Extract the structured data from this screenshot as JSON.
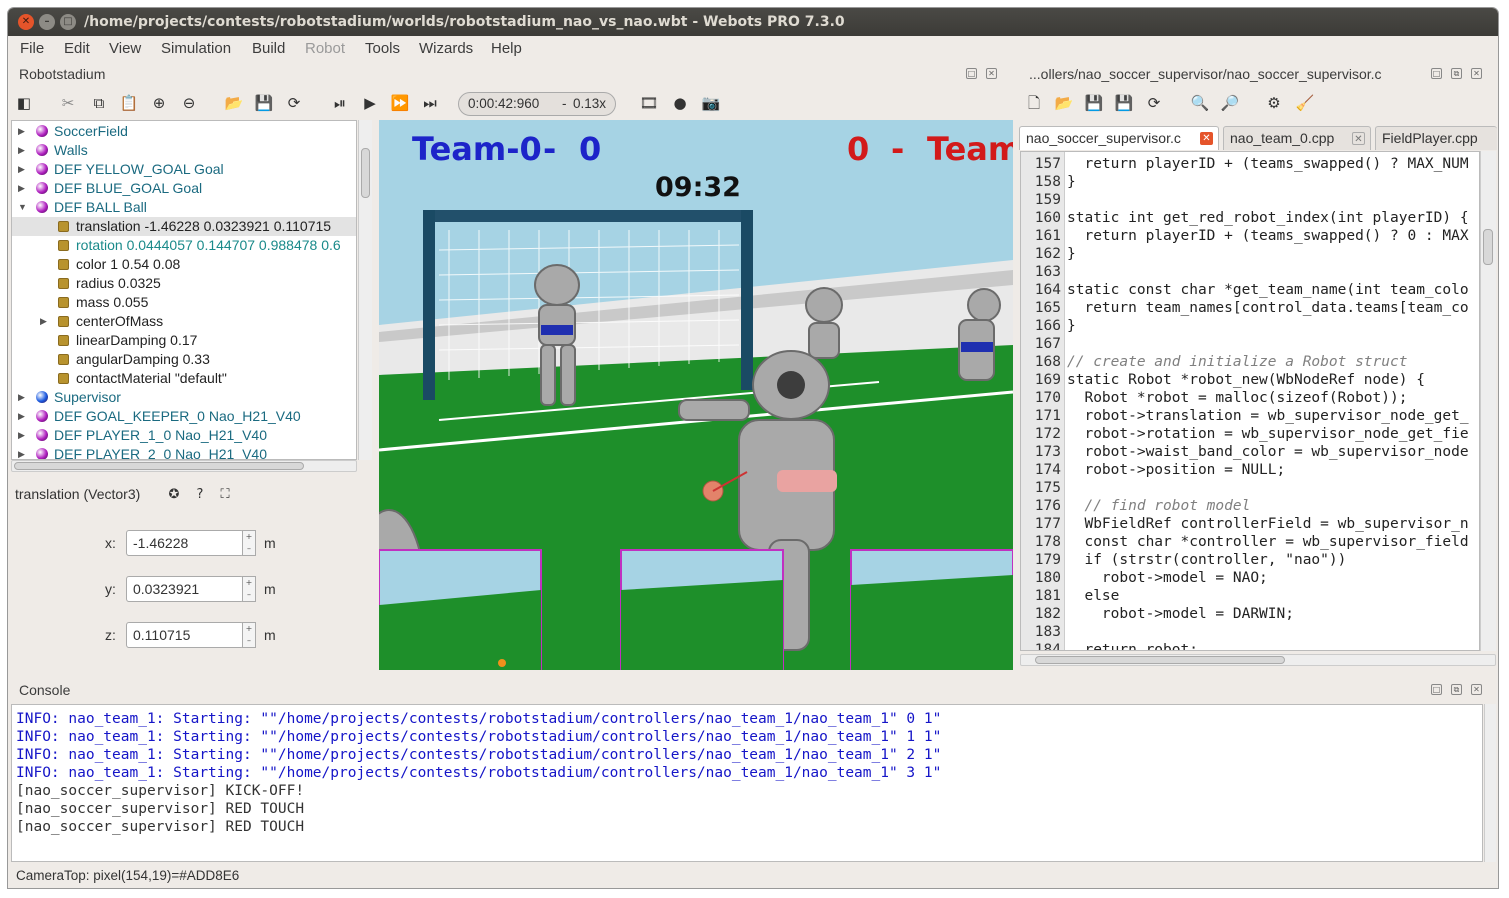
{
  "window": {
    "title": "/home/projects/contests/robotstadium/worlds/robotstadium_nao_vs_nao.wbt - Webots PRO 7.3.0"
  },
  "menu": [
    "File",
    "Edit",
    "View",
    "Simulation",
    "Build",
    "Robot",
    "Tools",
    "Wizards",
    "Help"
  ],
  "scene_panel": {
    "title": "Robotstadium",
    "sim_time": "0:00:42:960",
    "speed": "0.13x"
  },
  "tree": [
    {
      "label": "SoccerField",
      "kind": "node",
      "color": "#b020c0"
    },
    {
      "label": "Walls",
      "kind": "node",
      "color": "#b020c0"
    },
    {
      "label": "DEF YELLOW_GOAL Goal",
      "kind": "node",
      "color": "#b020c0"
    },
    {
      "label": "DEF BLUE_GOAL Goal",
      "kind": "node",
      "color": "#b020c0"
    },
    {
      "label": "DEF BALL Ball",
      "kind": "node",
      "color": "#b020c0",
      "expanded": true
    },
    {
      "label": "translation -1.46228 0.0323921 0.110715",
      "kind": "field",
      "selected": true
    },
    {
      "label": "rotation 0.0444057 0.144707 0.988478 0.6",
      "kind": "field",
      "teal": true
    },
    {
      "label": "color 1 0.54 0.08",
      "kind": "field"
    },
    {
      "label": "radius 0.0325",
      "kind": "field"
    },
    {
      "label": "mass 0.055",
      "kind": "field"
    },
    {
      "label": "centerOfMass",
      "kind": "field",
      "arrow": true
    },
    {
      "label": "linearDamping 0.17",
      "kind": "field"
    },
    {
      "label": "angularDamping 0.33",
      "kind": "field"
    },
    {
      "label": "contactMaterial \"default\"",
      "kind": "field"
    },
    {
      "label": "Supervisor",
      "kind": "node",
      "color": "#1a5ae0"
    },
    {
      "label": "DEF GOAL_KEEPER_0 Nao_H21_V40",
      "kind": "node",
      "color": "#b020c0"
    },
    {
      "label": "DEF PLAYER_1_0 Nao_H21_V40",
      "kind": "node",
      "color": "#b020c0"
    },
    {
      "label": "DEF PLAYER_2_0 Nao_H21_V40",
      "kind": "node",
      "color": "#b020c0"
    }
  ],
  "field_editor": {
    "title": "translation (Vector3)",
    "x_label": "x:",
    "y_label": "y:",
    "z_label": "z:",
    "x": "-1.46228",
    "y": "0.0323921",
    "z": "0.110715",
    "unit": "m"
  },
  "scene": {
    "team0": "Team-0",
    "score0": "0",
    "dash": "-",
    "score1": "0",
    "team1": "Team-",
    "clock": "09:32"
  },
  "editor": {
    "title": "...ollers/nao_soccer_supervisor/nao_soccer_supervisor.c",
    "tabs": [
      "nao_soccer_supervisor.c",
      "nao_team_0.cpp",
      "FieldPlayer.cpp"
    ],
    "lines": [
      {
        "n": "157",
        "t": "  return playerID + (teams_swapped() ? MAX_NUM"
      },
      {
        "n": "158",
        "t": "}"
      },
      {
        "n": "159",
        "t": ""
      },
      {
        "n": "160",
        "t": "static int get_red_robot_index(int playerID) {"
      },
      {
        "n": "161",
        "t": "  return playerID + (teams_swapped() ? 0 : MAX"
      },
      {
        "n": "162",
        "t": "}"
      },
      {
        "n": "163",
        "t": ""
      },
      {
        "n": "164",
        "t": "static const char *get_team_name(int team_colo"
      },
      {
        "n": "165",
        "t": "  return team_names[control_data.teams[team_co"
      },
      {
        "n": "166",
        "t": "}"
      },
      {
        "n": "167",
        "t": ""
      },
      {
        "n": "168",
        "t": "// create and initialize a Robot struct"
      },
      {
        "n": "169",
        "t": "static Robot *robot_new(WbNodeRef node) {"
      },
      {
        "n": "170",
        "t": "  Robot *robot = malloc(sizeof(Robot));"
      },
      {
        "n": "171",
        "t": "  robot->translation = wb_supervisor_node_get_"
      },
      {
        "n": "172",
        "t": "  robot->rotation = wb_supervisor_node_get_fie"
      },
      {
        "n": "173",
        "t": "  robot->waist_band_color = wb_supervisor_node"
      },
      {
        "n": "174",
        "t": "  robot->position = NULL;"
      },
      {
        "n": "175",
        "t": ""
      },
      {
        "n": "176",
        "t": "  // find robot model"
      },
      {
        "n": "177",
        "t": "  WbFieldRef controllerField = wb_supervisor_n"
      },
      {
        "n": "178",
        "t": "  const char *controller = wb_supervisor_field"
      },
      {
        "n": "179",
        "t": "  if (strstr(controller, \"nao\"))"
      },
      {
        "n": "180",
        "t": "    robot->model = NAO;"
      },
      {
        "n": "181",
        "t": "  else"
      },
      {
        "n": "182",
        "t": "    robot->model = DARWIN;"
      },
      {
        "n": "183",
        "t": ""
      },
      {
        "n": "184",
        "t": "  return robot;"
      }
    ]
  },
  "console": {
    "title": "Console",
    "lines": [
      {
        "t": "INFO: nao_team_1: Starting: \"\"/home/projects/contests/robotstadium/controllers/nao_team_1/nao_team_1\" 0 1\"",
        "c": "#1515c8"
      },
      {
        "t": "INFO: nao_team_1: Starting: \"\"/home/projects/contests/robotstadium/controllers/nao_team_1/nao_team_1\" 1 1\"",
        "c": "#1515c8"
      },
      {
        "t": "INFO: nao_team_1: Starting: \"\"/home/projects/contests/robotstadium/controllers/nao_team_1/nao_team_1\" 2 1\"",
        "c": "#1515c8"
      },
      {
        "t": "INFO: nao_team_1: Starting: \"\"/home/projects/contests/robotstadium/controllers/nao_team_1/nao_team_1\" 3 1\"",
        "c": "#1515c8"
      },
      {
        "t": "[nao_soccer_supervisor] KICK-OFF!",
        "c": "#333333"
      },
      {
        "t": "[nao_soccer_supervisor] RED TOUCH",
        "c": "#333333"
      },
      {
        "t": "[nao_soccer_supervisor] RED TOUCH",
        "c": "#333333"
      }
    ]
  },
  "status": "CameraTop: pixel(154,19)=#ADD8E6"
}
